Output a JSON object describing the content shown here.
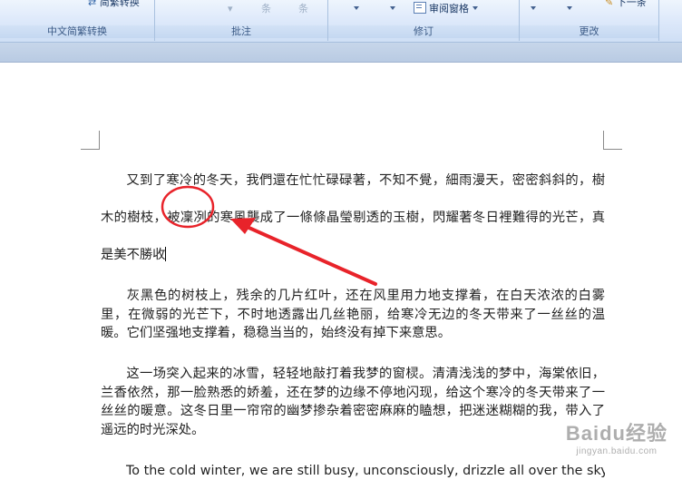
{
  "ribbon": {
    "convert": {
      "button": "简繁转换",
      "group": "中文简繁转换"
    },
    "comments": {
      "prev": "条",
      "next": "条",
      "group": "批注"
    },
    "tracking": {
      "review_pane": "审阅窗格",
      "group": "修订"
    },
    "changes": {
      "next": "下一条",
      "group": "更改"
    }
  },
  "document": {
    "p1": "又到了寒冷的冬天，我們還在忙忙碌碌著，不知不覺，細雨漫天，密密斜斜的，樹木的樹枝，被凜冽的寒風襲成了一條條晶瑩剔透的玉樹，閃耀著冬日裡難得的光芒，真是美不勝收",
    "p2": "灰黑色的树枝上，残余的几片红叶，还在风里用力地支撑着，在白天浓浓的白雾里，在微弱的光芒下，不时地透露出几丝艳丽，给寒冷无边的冬天带来了一丝丝的温暖。它们坚强地支撑着，稳稳当当的，始终没有掉下来意思。",
    "p3": "这一场突入起来的冰雪，轻轻地敲打着我梦的窗棂。清清浅浅的梦中，海棠依旧，兰香依然，那一脸熟悉的娇羞，还在梦的边缘不停地闪现，给这个寒冷的冬天带来了一丝丝的暖意。这冬日里一帘帘的幽梦掺杂着密密麻麻的瞌想，把迷迷糊糊的我，带入了遥远的时光深处。",
    "p4": "To the cold winter, we are still busy, unconsciously, drizzle all over the sky"
  },
  "watermark": {
    "main": "Baidu经验",
    "sub": "jingyan.baidu.com"
  },
  "colors": {
    "annotation": "#e8232a"
  }
}
